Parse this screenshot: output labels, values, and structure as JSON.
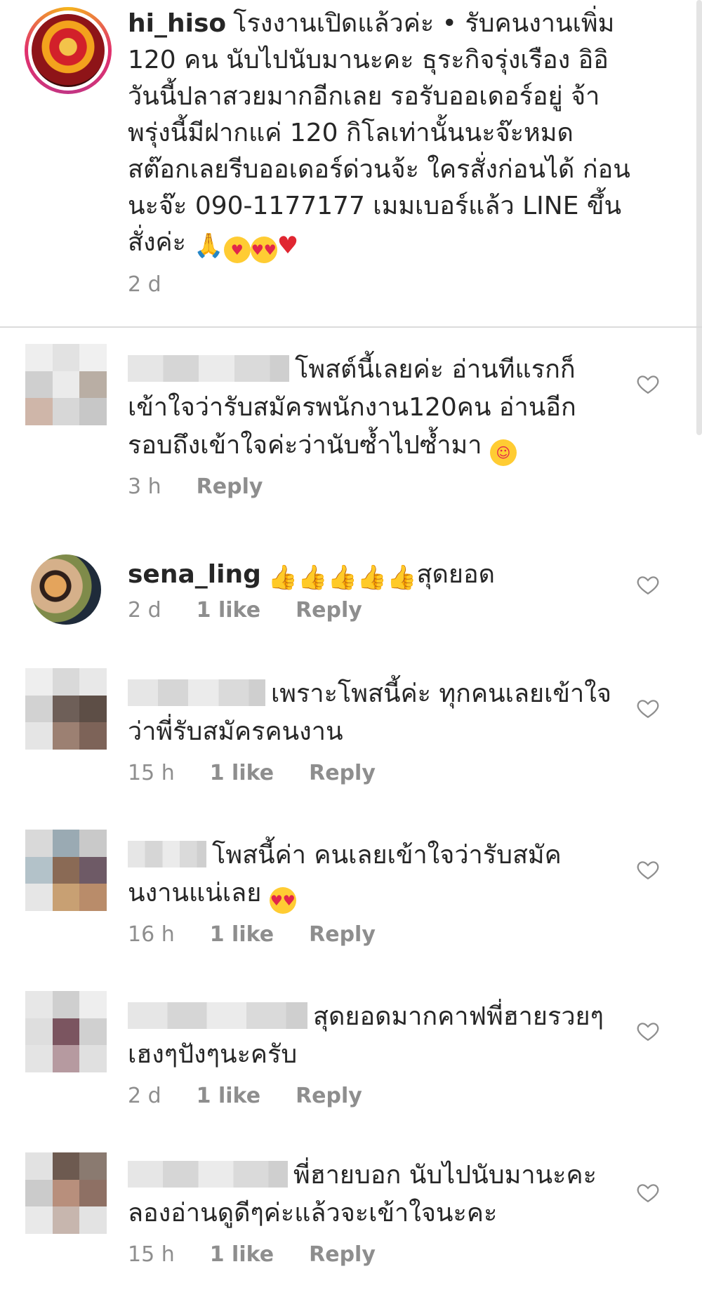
{
  "caption": {
    "username": "hi_hiso",
    "text": "โรงงานเปิดแล้วค่ะ • รับคนงานเพิ่ม 120 คน นับไปนับมานะคะ ธุระกิจรุ่งเรือง อิอิ วันนี้ปลาสวยมากอีกเลย รอรับออเดอร์อยู่ จ้า พรุ่งนี้มีฝากแค่ 120 กิโลเท่านั้นนะจ๊ะหมด สต๊อกเลยรีบออเดอร์ด่วนจ้ะ ใครสั่งก่อนได้ ก่อนนะจ๊ะ 090-1177177 เมมเบอร์แล้ว LINE ขึ้นสั่งค่ะ",
    "time": "2 d"
  },
  "comments": [
    {
      "username": "",
      "text": "โพสต์นี้เลยค่ะ  อ่านทีแรกก็เข้าใจว่ารับสมัครพนักงาน120คน อ่านอีกรอบถึงเข้าใจค่ะว่านับซ้ำไปซ้ำมา",
      "time": "3 h",
      "likes": "",
      "reply": "Reply"
    },
    {
      "username": "sena_ling",
      "text": "สุดยอด",
      "time": "2 d",
      "likes": "1 like",
      "reply": "Reply"
    },
    {
      "username": "",
      "text": "เพราะโพสนี้ค่ะ ทุกคนเลยเข้าใจว่าพี่รับสมัครคนงาน",
      "time": "15 h",
      "likes": "1 like",
      "reply": "Reply"
    },
    {
      "username": "",
      "text": "โพสนี้ค่า คนเลยเข้าใจว่ารับสมัคนงานแน่เลย",
      "time": "16 h",
      "likes": "1 like",
      "reply": "Reply"
    },
    {
      "username": "",
      "text": "สุดยอดมากคาฟพี่ฮายรวยๆเฮงๆปังๆนะครับ",
      "time": "2 d",
      "likes": "1 like",
      "reply": "Reply"
    },
    {
      "username": "",
      "text": "พี่ฮายบอก  นับไปนับมานะคะ  ลองอ่านดูดีๆค่ะแล้วจะเข้าใจนะคะ",
      "time": "15 h",
      "likes": "1 like",
      "reply": "Reply"
    }
  ],
  "icons": {
    "like": "heart-outline-icon",
    "pray": "folded-hands-icon",
    "kiss": "kissing-face-icon",
    "hearteyes": "heart-eyes-icon",
    "heart": "red-heart-icon",
    "thumbs": "thumbs-up-icon",
    "sweat": "grinning-sweat-icon"
  }
}
